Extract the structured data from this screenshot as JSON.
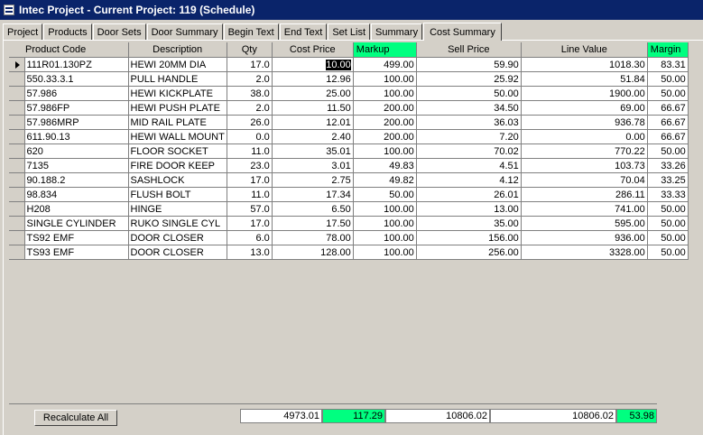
{
  "window": {
    "title": "Intec Project - Current Project: 119 (Schedule)"
  },
  "tabs": [
    {
      "label": "Project"
    },
    {
      "label": "Products"
    },
    {
      "label": "Door Sets"
    },
    {
      "label": "Door Summary"
    },
    {
      "label": "Begin Text"
    },
    {
      "label": "End Text"
    },
    {
      "label": "Set List"
    },
    {
      "label": "Summary"
    },
    {
      "label": "Cost Summary",
      "active": true
    }
  ],
  "columns": {
    "product_code": "Product Code",
    "description": "Description",
    "qty": "Qty",
    "cost_price": "Cost Price",
    "markup": "Markup",
    "sell_price": "Sell Price",
    "line_value": "Line Value",
    "margin": "Margin"
  },
  "highlight_color": "#00ff80",
  "rows": [
    {
      "code": "111R01.130PZ",
      "desc": "HEWI 20MM DIA",
      "qty": "17.0",
      "cost": "10.00",
      "markup": "499.00",
      "sell": "59.90",
      "line": "1018.30",
      "margin": "83.31",
      "current": true
    },
    {
      "code": "550.33.3.1",
      "desc": "PULL HANDLE",
      "qty": "2.0",
      "cost": "12.96",
      "markup": "100.00",
      "sell": "25.92",
      "line": "51.84",
      "margin": "50.00"
    },
    {
      "code": "57.986",
      "desc": "HEWI KICKPLATE",
      "qty": "38.0",
      "cost": "25.00",
      "markup": "100.00",
      "sell": "50.00",
      "line": "1900.00",
      "margin": "50.00"
    },
    {
      "code": "57.986FP",
      "desc": "HEWI PUSH PLATE",
      "qty": "2.0",
      "cost": "11.50",
      "markup": "200.00",
      "sell": "34.50",
      "line": "69.00",
      "margin": "66.67"
    },
    {
      "code": "57.986MRP",
      "desc": "MID RAIL PLATE",
      "qty": "26.0",
      "cost": "12.01",
      "markup": "200.00",
      "sell": "36.03",
      "line": "936.78",
      "margin": "66.67"
    },
    {
      "code": "611.90.13",
      "desc": "HEWI WALL MOUNT",
      "qty": "0.0",
      "cost": "2.40",
      "markup": "200.00",
      "sell": "7.20",
      "line": "0.00",
      "margin": "66.67"
    },
    {
      "code": "620",
      "desc": "FLOOR SOCKET",
      "qty": "11.0",
      "cost": "35.01",
      "markup": "100.00",
      "sell": "70.02",
      "line": "770.22",
      "margin": "50.00"
    },
    {
      "code": "7135",
      "desc": "FIRE DOOR KEEP",
      "qty": "23.0",
      "cost": "3.01",
      "markup": "49.83",
      "sell": "4.51",
      "line": "103.73",
      "margin": "33.26"
    },
    {
      "code": "90.188.2",
      "desc": "SASHLOCK",
      "qty": "17.0",
      "cost": "2.75",
      "markup": "49.82",
      "sell": "4.12",
      "line": "70.04",
      "margin": "33.25"
    },
    {
      "code": "98.834",
      "desc": "FLUSH BOLT",
      "qty": "11.0",
      "cost": "17.34",
      "markup": "50.00",
      "sell": "26.01",
      "line": "286.11",
      "margin": "33.33"
    },
    {
      "code": "H208",
      "desc": "HINGE",
      "qty": "57.0",
      "cost": "6.50",
      "markup": "100.00",
      "sell": "13.00",
      "line": "741.00",
      "margin": "50.00"
    },
    {
      "code": "SINGLE CYLINDER",
      "desc": "RUKO SINGLE CYL",
      "qty": "17.0",
      "cost": "17.50",
      "markup": "100.00",
      "sell": "35.00",
      "line": "595.00",
      "margin": "50.00"
    },
    {
      "code": "TS92 EMF",
      "desc": "DOOR CLOSER",
      "qty": "6.0",
      "cost": "78.00",
      "markup": "100.00",
      "sell": "156.00",
      "line": "936.00",
      "margin": "50.00"
    },
    {
      "code": "TS93 EMF",
      "desc": "DOOR CLOSER",
      "qty": "13.0",
      "cost": "128.00",
      "markup": "100.00",
      "sell": "256.00",
      "line": "3328.00",
      "margin": "50.00"
    }
  ],
  "totals": {
    "cost": "4973.01",
    "markup": "117.29",
    "sell": "10806.02",
    "line": "10806.02",
    "margin": "53.98"
  },
  "buttons": {
    "recalculate": "Recalculate All"
  }
}
